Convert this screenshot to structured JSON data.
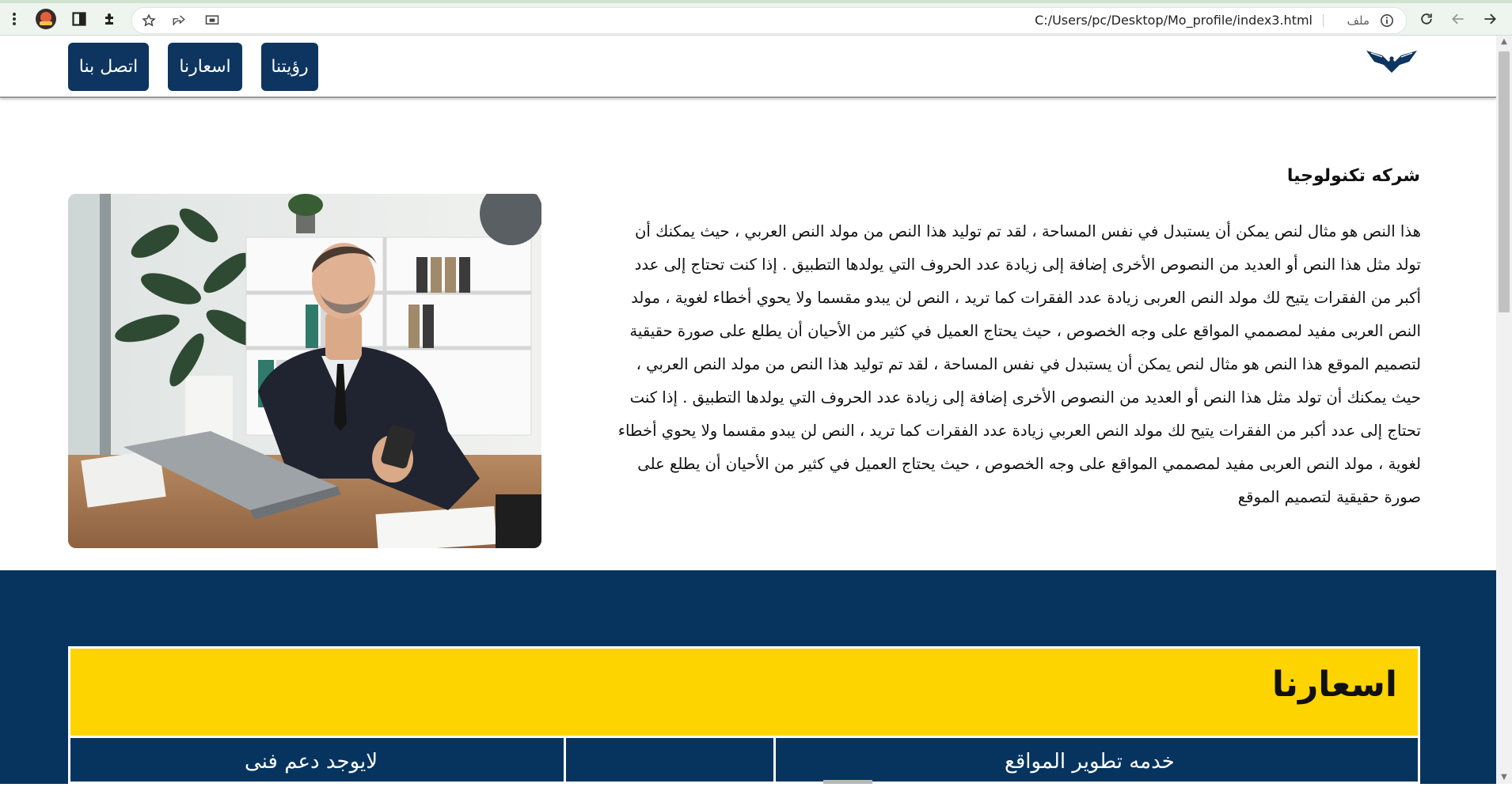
{
  "browser": {
    "url": "C:/Users/pc/Desktop/Mo_profile/index3.html",
    "file_label": "ملف"
  },
  "nav": {
    "vision_label": "رؤيتنا",
    "prices_label": "اسعارنا",
    "contact_label": "اتصل بنا"
  },
  "company": {
    "title": "شركه تكنولوجيا",
    "paragraph": "هذا النص هو مثال لنص يمكن أن يستبدل في نفس المساحة ، لقد تم توليد هذا النص من مولد النص العربي ، حيث يمكنك أن تولد مثل هذا النص أو العديد من النصوص الأخرى إضافة إلى زيادة عدد الحروف التي يولدها التطبيق . إذا كنت تحتاج إلى عدد أكبر من الفقرات يتيح لك مولد النص العربى زيادة عدد الفقرات كما تريد ، النص لن يبدو مقسما ولا يحوي أخطاء لغوية ، مولد النص العربى مفيد لمصممي المواقع على وجه الخصوص ، حيث يحتاج العميل في كثير من الأحيان أن يطلع على صورة حقيقية لتصميم الموقع هذا النص هو مثال لنص يمكن أن يستبدل في نفس المساحة ، لقد تم توليد هذا النص من مولد النص العربي ، حيث يمكنك أن تولد مثل هذا النص أو العديد من النصوص الأخرى إضافة إلى زيادة عدد الحروف التي يولدها التطبيق . إذا كنت تحتاج إلى عدد أكبر من الفقرات يتيح لك مولد النص العربي زيادة عدد الفقرات كما تريد ، النص لن يبدو مقسما ولا يحوي أخطاء لغوية ، مولد النص العربى مفيد لمصممي المواقع على وجه الخصوص ، حيث يحتاج العميل في كثير من الأحيان أن يطلع على صورة حقيقية لتصميم الموقع"
  },
  "prices": {
    "title": "اسعارنا",
    "cells": [
      "خدمه تطوير المواقع",
      "",
      "لايوجد دعم فنى"
    ]
  },
  "colors": {
    "navy": "#0d3560",
    "section_blue": "#06345e",
    "yellow": "#fdd400"
  },
  "icons": {
    "logo": "eagle-logo-icon",
    "browser": [
      "menu-dots-icon",
      "profile-avatar-icon",
      "side-panel-icon",
      "extensions-icon",
      "star-icon",
      "share-icon",
      "screen-cast-icon",
      "info-icon",
      "reload-icon",
      "back-arrow-icon",
      "forward-arrow-icon"
    ]
  }
}
